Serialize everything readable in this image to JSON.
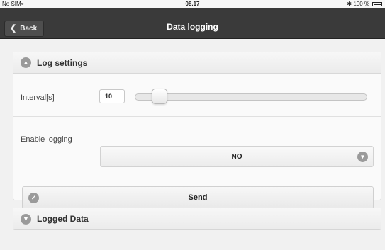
{
  "status_bar": {
    "carrier": "No SIM",
    "wifi_icon": "wifi-icon",
    "time": "08.17",
    "right_text": "✱ 100 %",
    "battery_level": 1.0
  },
  "nav": {
    "back_label": "Back",
    "title": "Data logging"
  },
  "log_settings": {
    "header": "Log settings",
    "header_icon": "chevron-up-circle-icon",
    "interval_label": "Interval[s]",
    "interval_value": "10",
    "slider_fraction": 0.08,
    "enable_label": "Enable logging",
    "enable_value": "NO",
    "send_label": "Send"
  },
  "logged_data": {
    "header": "Logged Data",
    "header_icon": "chevron-down-circle-icon"
  },
  "colors": {
    "navbar": "#3a3a3a",
    "icon_gray": "#9a9a9a",
    "background": "#f1f1f1"
  }
}
